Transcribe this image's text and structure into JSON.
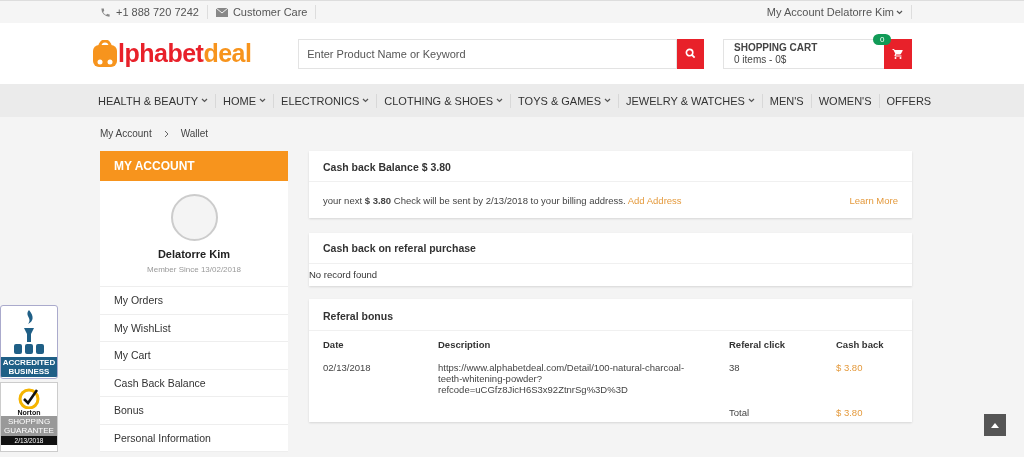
{
  "top_bar": {
    "phone": "+1 888 720 7242",
    "customer_care": "Customer Care",
    "account": "My Account Delatorre Kim"
  },
  "header": {
    "logo": {
      "first": "lphabet",
      "second": "deal"
    },
    "search": {
      "placeholder": "Enter Product Name or Keyword"
    },
    "cart": {
      "title": "SHOPPING CART",
      "summary": "0 items - 0$",
      "count": "0"
    }
  },
  "nav": [
    {
      "label": "HEALTH & BEAUTY",
      "dropdown": true
    },
    {
      "label": "HOME",
      "dropdown": true
    },
    {
      "label": "ELECTRONICS",
      "dropdown": true
    },
    {
      "label": "CLOTHING & SHOES",
      "dropdown": true
    },
    {
      "label": "TOYS & GAMES",
      "dropdown": true
    },
    {
      "label": "JEWELRY & WATCHES",
      "dropdown": true
    },
    {
      "label": "MEN'S",
      "dropdown": false
    },
    {
      "label": "WOMEN'S",
      "dropdown": false
    },
    {
      "label": "OFFERS",
      "dropdown": false
    }
  ],
  "breadcrumb": [
    "My Account",
    "Wallet"
  ],
  "sidebar": {
    "title": "MY ACCOUNT",
    "name": "Delatorre Kim",
    "member_since": "Member Since 13/02/2018",
    "items": [
      "My Orders",
      "My WishList",
      "My Cart",
      "Cash Back Balance",
      "Bonus",
      "Personal Information"
    ]
  },
  "balance_card": {
    "title": "Cash back Balance $ 3.80",
    "message": "your next **$ 3.80** Check will be sent by 2/13/2018 to your billing address.",
    "add_address": "Add Address",
    "learn_more": "Learn More"
  },
  "referal_purchase_card": {
    "title": "Cash back on referal purchase",
    "empty": "No record found"
  },
  "referal_bonus_card": {
    "title": "Referal bonus",
    "columns": [
      "Date",
      "Description",
      "Referal click",
      "Cash back"
    ],
    "rows": [
      [
        "02/13/2018",
        "https://www.alphabetdeal.com/Detail/100-natural-charcoal-teeth-whitening-powder?refcode=uCGfz8JicH6S3x92ZtnrSg%3D%3D",
        "38",
        "$ 3.80"
      ]
    ],
    "total_label": "Total",
    "total_value": "$ 3.80"
  },
  "badges": {
    "bbb": [
      "ACCREDITED",
      "BUSINESS"
    ],
    "norton": {
      "name": "Norton",
      "caption": [
        "SHOPPING",
        "GUARANTEE"
      ],
      "date": "2/13/2018"
    }
  }
}
